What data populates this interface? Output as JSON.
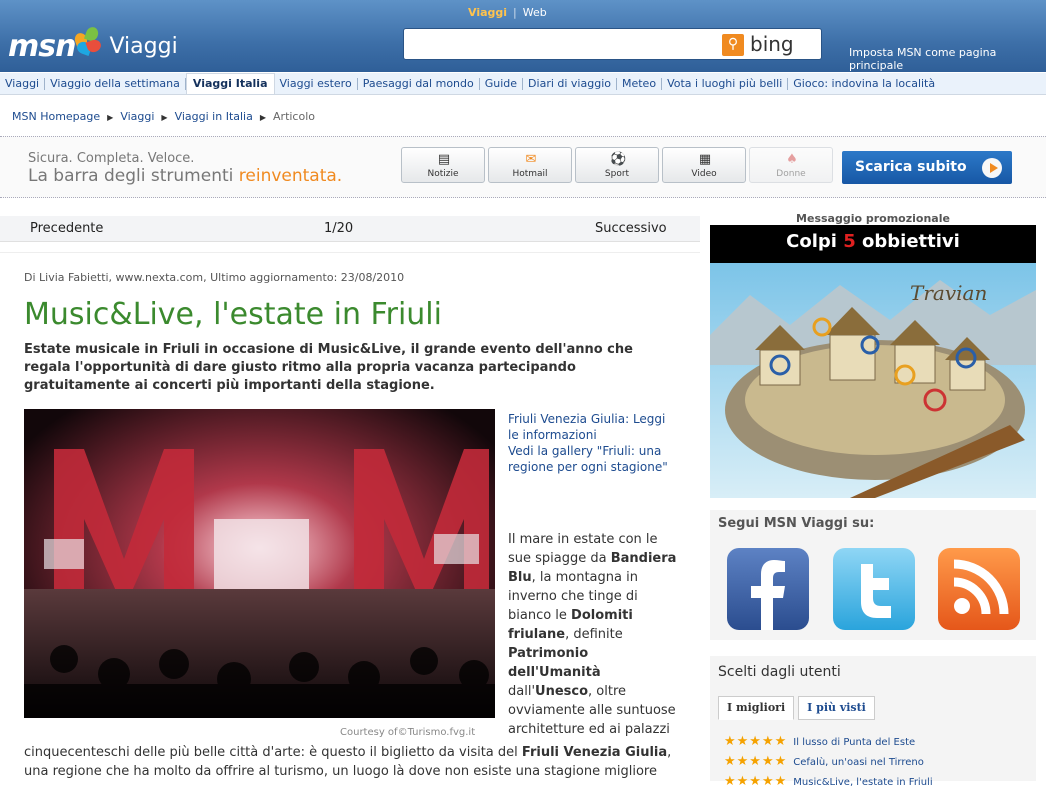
{
  "header": {
    "brand": "msn",
    "section": "Viaggi",
    "search_tabs": [
      "Viaggi",
      "Web"
    ],
    "search_placeholder": "",
    "search_engine": "bing",
    "set_homepage": "Imposta MSN come pagina principale"
  },
  "nav": {
    "items": [
      "Viaggi",
      "Viaggio della settimana",
      "Viaggi Italia",
      "Viaggi estero",
      "Paesaggi dal mondo",
      "Guide",
      "Diari di viaggio",
      "Meteo",
      "Vota i luoghi più belli",
      "Gioco: indovina la località"
    ],
    "active": "Viaggi Italia"
  },
  "breadcrumb": [
    "MSN Homepage",
    "Viaggi",
    "Viaggi in Italia",
    "Articolo"
  ],
  "banner": {
    "line1": "Sicura. Completa. Veloce.",
    "line2_start": "La barra degli strumenti ",
    "line2_highlight": "reinventata.",
    "buttons": [
      "Notizie",
      "Hotmail",
      "Sport",
      "Video",
      "Donne"
    ],
    "cta": "Scarica subito"
  },
  "pager": {
    "prev": "Precedente",
    "position": "1/20",
    "next": "Successivo"
  },
  "article": {
    "byline": "Di Livia Fabietti, www.nexta.com, Ultimo aggiornamento: 23/08/2010",
    "title": "Music&Live, l'estate in Friuli",
    "lead": "Estate musicale in Friuli in occasione di Music&Live, il grande evento dell'anno che regala l'opportunità di dare giusto ritmo alla propria vacanza partecipando gratuitamente ai concerti più importanti della stagione.",
    "photo_credit": "Courtesy of©Turismo.fvg.it",
    "link1": "Friuli Venezia Giulia: Leggi le informazioni",
    "link2": "Vedi la gallery \"Friuli: una regione per ogni stagione\"",
    "side_text": {
      "t1": "Il mare in estate con le sue spiagge da ",
      "b1": "Bandiera Blu",
      "t2": ", la montagna in inverno che tinge di bianco le ",
      "b2": "Dolomiti friulane",
      "t3": ", definite ",
      "b3": "Patrimonio dell'Umanità",
      "t4": " dall'",
      "b4": "Unesco",
      "t5": ", oltre ovviamente alle suntuose architetture ed ai palazzi"
    },
    "tail": {
      "t1": "cinquecenteschi delle più belle città d'arte: è questo il biglietto da visita del ",
      "b1": "Friuli Venezia Giulia",
      "t2": ", una regione che ha molto da offrire al turismo, un luogo là dove non esiste una stagione migliore"
    }
  },
  "sidebar": {
    "promo_label": "Messaggio promozionale",
    "ad_title_start": "Colpi ",
    "ad_title_num": "5",
    "ad_title_end": " obbiettivi",
    "follow_title": "Segui MSN Viaggi su:",
    "social": [
      "facebook-icon",
      "twitter-icon",
      "rss-icon"
    ],
    "users_title": "Scelti dagli utenti",
    "users_tabs": [
      "I migliori",
      "I più visti"
    ],
    "users_list": [
      "Il lusso di Punta del Este",
      "Cefalù, un'oasi nel Tirreno",
      "Music&Live, l'estate in Friuli"
    ],
    "stars": "★★★★★"
  },
  "colors": {
    "header": "#3d6fa8",
    "title_green": "#3b8a2e",
    "link": "#1d4b8f",
    "accent": "#f08a20"
  }
}
